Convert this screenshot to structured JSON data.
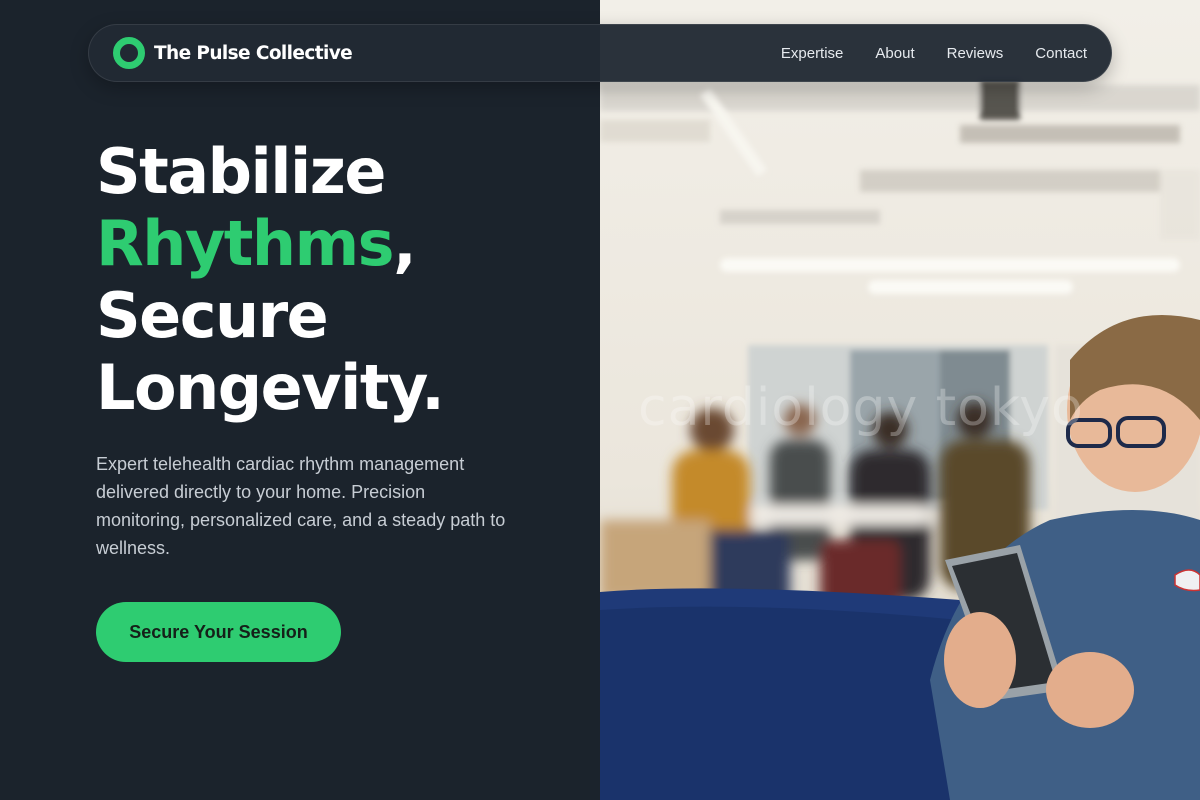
{
  "brand": {
    "name": "The Pulse Collective",
    "accent_color": "#2ecc71"
  },
  "nav": {
    "links": [
      {
        "label": "Expertise"
      },
      {
        "label": "About"
      },
      {
        "label": "Reviews"
      },
      {
        "label": "Contact"
      }
    ]
  },
  "hero": {
    "line1": "Stabilize",
    "line2_accent": "Rhythms",
    "line2_rest": ",",
    "line3": "Secure",
    "line4": "Longevity.",
    "description": "Expert telehealth cardiac rhythm management delivered directly to your home. Precision monitoring, personalized care, and a steady path to wellness.",
    "cta_label": "Secure Your Session"
  },
  "photo": {
    "watermark": "cardiology tokyo",
    "icon": "photo-person-with-tablet"
  }
}
